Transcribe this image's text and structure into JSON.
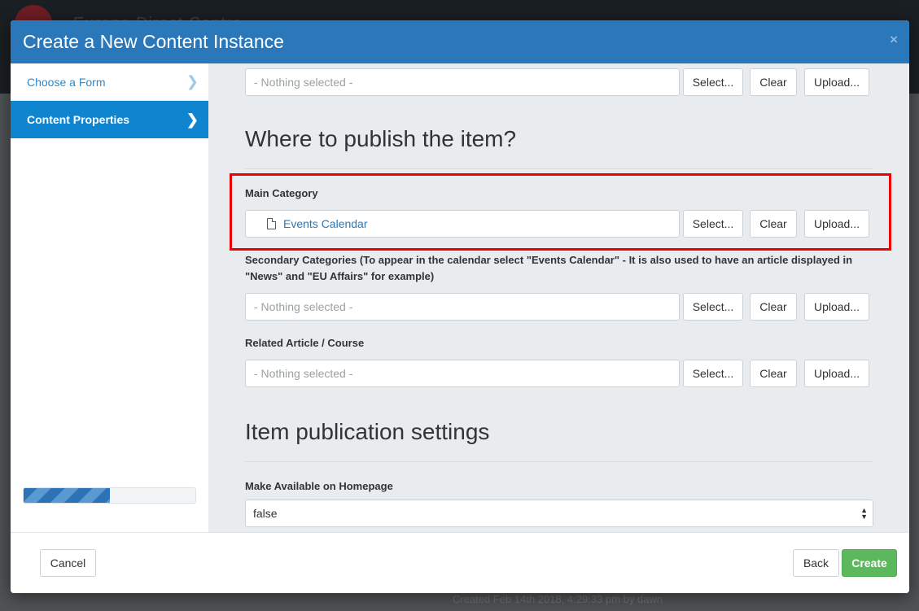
{
  "background": {
    "site_title": "Europe  Direct  Centre",
    "meta_text": "Created Feb 14th 2018, 4:29:33 pm by dawn"
  },
  "modal": {
    "title": "Create a New Content Instance",
    "close_icon": "×"
  },
  "sidebar": {
    "items": [
      {
        "label": "Choose a Form",
        "active": false,
        "icon": "chevron-right-icon"
      },
      {
        "label": "Content Properties",
        "active": true,
        "icon": "chevron-right-icon"
      }
    ],
    "progress_fraction": 0.5
  },
  "buttons": {
    "select": "Select...",
    "clear": "Clear",
    "upload": "Upload..."
  },
  "top_field": {
    "placeholder": "- Nothing selected -"
  },
  "publish_section": {
    "heading": "Where to publish the item?",
    "main_category": {
      "label": "Main Category",
      "value": "Events Calendar",
      "icon": "document-icon"
    },
    "secondary_categories": {
      "label": "Secondary Categories (To appear in the calendar select \"Events Calendar\" - It is also used to have an article displayed in \"News\" and \"EU Affairs\" for example)",
      "placeholder": "- Nothing selected -"
    },
    "related_article": {
      "label": "Related Article / Course",
      "placeholder": "- Nothing selected -"
    }
  },
  "publication_settings": {
    "heading": "Item publication settings",
    "homepage": {
      "label": "Make Available on Homepage",
      "value": "false"
    }
  },
  "footer": {
    "cancel": "Cancel",
    "back": "Back",
    "create": "Create"
  },
  "colors": {
    "header": "#2a77b9",
    "sidebar_active": "#0f84cf",
    "create_button": "#5cb85c",
    "highlight": "#ee0000"
  }
}
